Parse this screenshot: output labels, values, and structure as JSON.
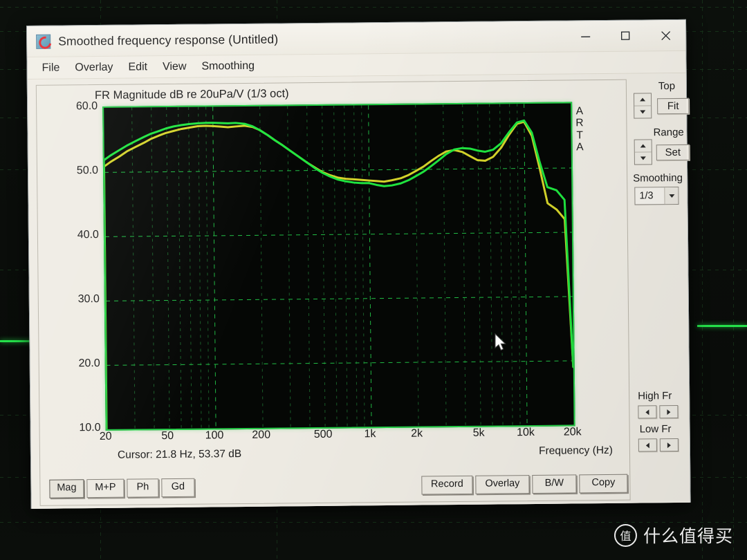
{
  "window": {
    "title": "Smoothed frequency response (Untitled)",
    "app_icon": "arta-logo-icon",
    "controls": {
      "minimize": "minimize-icon",
      "maximize": "maximize-icon",
      "close": "close-icon"
    }
  },
  "menubar": {
    "items": [
      {
        "label": "File"
      },
      {
        "label": "Overlay"
      },
      {
        "label": "Edit"
      },
      {
        "label": "View"
      },
      {
        "label": "Smoothing"
      }
    ]
  },
  "plot": {
    "title": "FR Magnitude dB re 20uPa/V (1/3 oct)",
    "watermark": "ARTA",
    "watermark_letters": [
      "A",
      "R",
      "T",
      "A"
    ],
    "cursor_readout": "Cursor: 21.8 Hz, 53.37 dB",
    "x_axis_title": "Frequency (Hz)"
  },
  "side_panel": {
    "top_label": "Top",
    "fit_label": "Fit",
    "range_label": "Range",
    "set_label": "Set",
    "smoothing_label": "Smoothing",
    "smoothing_value": "1/3",
    "smoothing_options": [
      "1/3"
    ],
    "high_fr_label": "High Fr",
    "low_fr_label": "Low Fr"
  },
  "bottom_bar": {
    "left_buttons": [
      {
        "label": "Mag",
        "pressed": true
      },
      {
        "label": "M+P",
        "pressed": false
      },
      {
        "label": "Ph",
        "pressed": false
      },
      {
        "label": "Gd",
        "pressed": false
      }
    ],
    "right_buttons": [
      {
        "label": "Record"
      },
      {
        "label": "Overlay"
      },
      {
        "label": "B/W"
      },
      {
        "label": "Copy"
      }
    ]
  },
  "watermark": {
    "badge": "值",
    "text": "什么值得买"
  },
  "colors": {
    "curve_green": "#1fe53f",
    "curve_yellow": "#d4d42a",
    "grid_green": "#22c948",
    "plot_background": "#050705",
    "window_face": "#efece4"
  },
  "chart_data": {
    "type": "line",
    "title": "FR Magnitude dB re 20uPa/V (1/3 oct)",
    "xlabel": "Frequency (Hz)",
    "ylabel": "FR Magnitude dB re 20uPa/V",
    "xscale": "log",
    "xlim": [
      20,
      20000
    ],
    "ylim": [
      10.0,
      60.0
    ],
    "ytick_labels": [
      "60.0",
      "50.0",
      "40.0",
      "30.0",
      "20.0",
      "10.0"
    ],
    "yticks": [
      60.0,
      50.0,
      40.0,
      30.0,
      20.0,
      10.0
    ],
    "xtick_labels": [
      "20",
      "50",
      "100",
      "200",
      "500",
      "1k",
      "2k",
      "5k",
      "10k",
      "20k"
    ],
    "xticks": [
      20,
      50,
      100,
      200,
      500,
      1000,
      2000,
      5000,
      10000,
      20000
    ],
    "grid": true,
    "legend": false,
    "series": [
      {
        "name": "green",
        "color": "#1fe53f",
        "x": [
          20,
          22,
          25,
          28,
          32,
          36,
          40,
          45,
          50,
          56,
          63,
          71,
          80,
          90,
          100,
          112,
          125,
          140,
          160,
          180,
          200,
          225,
          250,
          280,
          315,
          355,
          400,
          450,
          500,
          560,
          630,
          710,
          800,
          900,
          1000,
          1120,
          1250,
          1400,
          1600,
          1800,
          2000,
          2250,
          2500,
          2800,
          3150,
          3550,
          4000,
          4500,
          5000,
          5600,
          6300,
          7100,
          8000,
          9000,
          10000,
          11200,
          12500,
          14000,
          16000,
          18000,
          20000
        ],
        "y": [
          51.9,
          52.6,
          53.4,
          54.1,
          54.8,
          55.4,
          55.9,
          56.3,
          56.7,
          57.0,
          57.2,
          57.35,
          57.45,
          57.5,
          57.5,
          57.45,
          57.4,
          57.45,
          57.3,
          56.9,
          56.3,
          55.5,
          54.7,
          53.9,
          53.0,
          52.1,
          51.2,
          50.3,
          49.6,
          49.0,
          48.5,
          48.2,
          48.0,
          47.9,
          47.9,
          47.6,
          47.4,
          47.5,
          47.8,
          48.3,
          48.9,
          49.6,
          50.4,
          51.3,
          52.3,
          53.0,
          53.2,
          53.1,
          52.8,
          52.6,
          52.9,
          53.9,
          55.6,
          57.1,
          57.4,
          55.5,
          51.0,
          47.0,
          46.5,
          45.0,
          19.0
        ]
      },
      {
        "name": "yellow",
        "color": "#d4d42a",
        "x": [
          20,
          22,
          25,
          28,
          32,
          36,
          40,
          45,
          50,
          56,
          63,
          71,
          80,
          90,
          100,
          112,
          125,
          140,
          160,
          180,
          200,
          225,
          250,
          280,
          315,
          355,
          400,
          450,
          500,
          560,
          630,
          710,
          800,
          900,
          1000,
          1120,
          1250,
          1400,
          1600,
          1800,
          2000,
          2250,
          2500,
          2800,
          3150,
          3550,
          4000,
          4500,
          5000,
          5600,
          6300,
          7100,
          8000,
          9000,
          10000,
          11200,
          12500,
          14000,
          16000,
          18000,
          20000
        ],
        "y": [
          50.9,
          51.6,
          52.4,
          53.2,
          53.9,
          54.5,
          55.1,
          55.6,
          56.0,
          56.3,
          56.6,
          56.8,
          57.0,
          57.05,
          57.0,
          56.9,
          56.8,
          56.9,
          57.0,
          56.8,
          56.3,
          55.5,
          54.7,
          53.9,
          53.0,
          52.1,
          51.2,
          50.4,
          49.7,
          49.2,
          48.8,
          48.6,
          48.5,
          48.4,
          48.3,
          48.2,
          48.1,
          48.3,
          48.6,
          49.1,
          49.7,
          50.4,
          51.2,
          52.0,
          52.7,
          52.9,
          52.6,
          51.9,
          51.3,
          51.2,
          51.8,
          53.2,
          55.2,
          56.9,
          57.2,
          55.0,
          50.0,
          44.5,
          43.5,
          42.0,
          19.0
        ]
      }
    ]
  }
}
